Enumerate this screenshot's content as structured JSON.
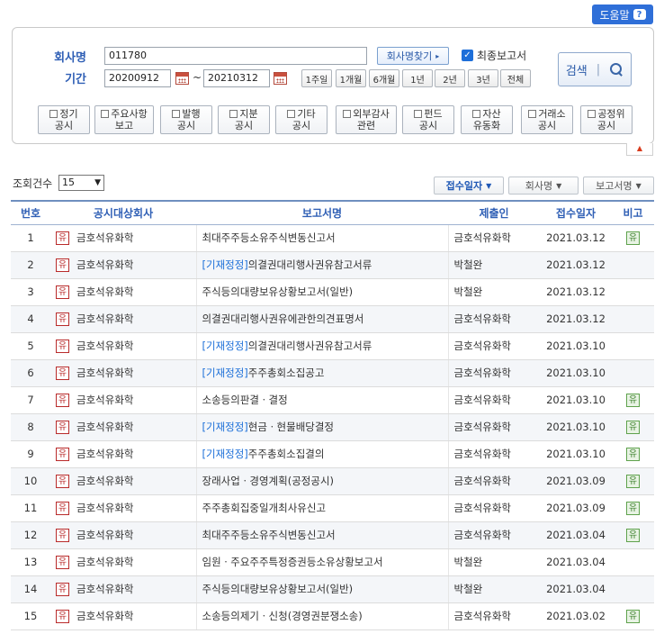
{
  "help": {
    "label": "도움말",
    "icon": "question-icon"
  },
  "form": {
    "company_label": "회사명",
    "company_value": "011780",
    "find_company_label": "회사명찾기",
    "final_report_label": "최종보고서",
    "final_report_checked": true,
    "period_label": "기간",
    "start_date": "20200912",
    "end_date": "20210312",
    "date_sep": "~",
    "period_buttons": [
      "1주일",
      "1개월",
      "6개월",
      "1년",
      "2년",
      "3년",
      "전체"
    ],
    "search_label": "검색",
    "categories": [
      [
        "정기",
        "공시"
      ],
      [
        "주요사항",
        "보고"
      ],
      [
        "발행",
        "공시"
      ],
      [
        "지분",
        "공시"
      ],
      [
        "기타",
        "공시"
      ],
      [
        "외부감사",
        "관련"
      ],
      [
        "펀드",
        "공시"
      ],
      [
        "자산",
        "유동화"
      ],
      [
        "거래소",
        "공시"
      ],
      [
        "공정위",
        "공시"
      ]
    ]
  },
  "list_controls": {
    "count_label": "조회건수",
    "count_value": "15",
    "sort_buttons": [
      "접수일자",
      "회사명",
      "보고서명"
    ],
    "active_sort": "접수일자"
  },
  "table": {
    "headers": [
      "번호",
      "공시대상회사",
      "보고서명",
      "제출인",
      "접수일자",
      "비고"
    ],
    "corp_badge": "유",
    "note_badge": "유",
    "rows": [
      {
        "no": "1",
        "company": "금호석유화학",
        "prefix": "",
        "report": "최대주주등소유주식변동신고서",
        "submitter": "금호석유화학",
        "date": "2021.03.12",
        "note": "유"
      },
      {
        "no": "2",
        "company": "금호석유화학",
        "prefix": "[기재정정]",
        "report": "의결권대리행사권유참고서류",
        "submitter": "박철완",
        "date": "2021.03.12",
        "note": ""
      },
      {
        "no": "3",
        "company": "금호석유화학",
        "prefix": "",
        "report": "주식등의대량보유상황보고서(일반)",
        "submitter": "박철완",
        "date": "2021.03.12",
        "note": ""
      },
      {
        "no": "4",
        "company": "금호석유화학",
        "prefix": "",
        "report": "의결권대리행사권유에관한의견표명서",
        "submitter": "금호석유화학",
        "date": "2021.03.12",
        "note": ""
      },
      {
        "no": "5",
        "company": "금호석유화학",
        "prefix": "[기재정정]",
        "report": "의결권대리행사권유참고서류",
        "submitter": "금호석유화학",
        "date": "2021.03.10",
        "note": ""
      },
      {
        "no": "6",
        "company": "금호석유화학",
        "prefix": "[기재정정]",
        "report": "주주총회소집공고",
        "submitter": "금호석유화학",
        "date": "2021.03.10",
        "note": ""
      },
      {
        "no": "7",
        "company": "금호석유화학",
        "prefix": "",
        "report": "소송등의판결ㆍ결정",
        "submitter": "금호석유화학",
        "date": "2021.03.10",
        "note": "유"
      },
      {
        "no": "8",
        "company": "금호석유화학",
        "prefix": "[기재정정]",
        "report": "현금ㆍ현물배당결정",
        "submitter": "금호석유화학",
        "date": "2021.03.10",
        "note": "유"
      },
      {
        "no": "9",
        "company": "금호석유화학",
        "prefix": "[기재정정]",
        "report": "주주총회소집결의",
        "submitter": "금호석유화학",
        "date": "2021.03.10",
        "note": "유"
      },
      {
        "no": "10",
        "company": "금호석유화학",
        "prefix": "",
        "report": "장래사업ㆍ경영계획(공정공시)",
        "submitter": "금호석유화학",
        "date": "2021.03.09",
        "note": "유"
      },
      {
        "no": "11",
        "company": "금호석유화학",
        "prefix": "",
        "report": "주주총회집중일개최사유신고",
        "submitter": "금호석유화학",
        "date": "2021.03.09",
        "note": "유"
      },
      {
        "no": "12",
        "company": "금호석유화학",
        "prefix": "",
        "report": "최대주주등소유주식변동신고서",
        "submitter": "금호석유화학",
        "date": "2021.03.04",
        "note": "유"
      },
      {
        "no": "13",
        "company": "금호석유화학",
        "prefix": "",
        "report": "임원ㆍ주요주주특정증권등소유상황보고서",
        "submitter": "박철완",
        "date": "2021.03.04",
        "note": ""
      },
      {
        "no": "14",
        "company": "금호석유화학",
        "prefix": "",
        "report": "주식등의대량보유상황보고서(일반)",
        "submitter": "박철완",
        "date": "2021.03.04",
        "note": ""
      },
      {
        "no": "15",
        "company": "금호석유화학",
        "prefix": "",
        "report": "소송등의제기ㆍ신청(경영권분쟁소송)",
        "submitter": "금호석유화학",
        "date": "2021.03.02",
        "note": "유"
      }
    ]
  }
}
